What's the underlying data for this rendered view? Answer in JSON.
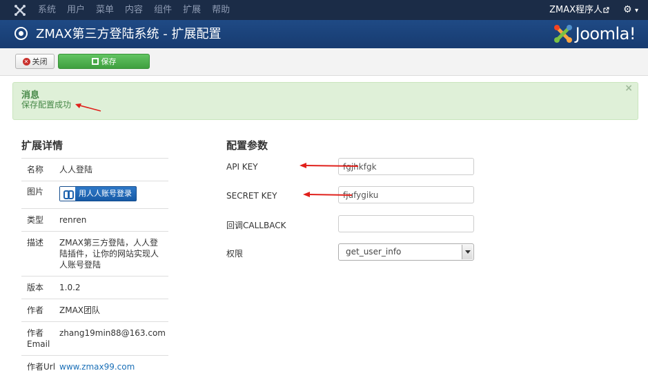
{
  "topnav": {
    "menu": [
      "系统",
      "用户",
      "菜单",
      "内容",
      "组件",
      "扩展",
      "帮助"
    ],
    "user": "ZMAX程序人",
    "gear_caret": "▾"
  },
  "header": {
    "title": "ZMAX第三方登陆系统 - 扩展配置",
    "brand": "Joomla!"
  },
  "toolbar": {
    "close_label": "关闭",
    "save_label": "保存"
  },
  "alert": {
    "heading": "消息",
    "message": "保存配置成功",
    "close": "×"
  },
  "details": {
    "title": "扩展详情",
    "rows": [
      {
        "label": "名称",
        "value": "人人登陆"
      },
      {
        "label": "图片",
        "value": "用人人账号登录"
      },
      {
        "label": "类型",
        "value": "renren"
      },
      {
        "label": "描述",
        "value": "ZMAX第三方登陆，人人登陆插件，让你的网站实现人人账号登陆"
      },
      {
        "label": "版本",
        "value": "1.0.2"
      },
      {
        "label": "作者",
        "value": "ZMAX团队"
      },
      {
        "label": "作者Email",
        "value": "zhang19min88@163.com"
      },
      {
        "label": "作者Url",
        "value": "www.zmax99.com"
      }
    ]
  },
  "config": {
    "title": "配置参数",
    "api_key_label": "API KEY",
    "api_key_value": "fgjhkfgk",
    "secret_key_label": "SECRET KEY",
    "secret_key_value": "fjufygiku",
    "callback_label": "回调CALLBACK",
    "callback_value": "",
    "scope_label": "权限",
    "scope_value": "get_user_info"
  },
  "colors": {
    "annotation_arrow": "#e0201b",
    "topnav_bg": "#1b2c47",
    "header_bg": "#1f4a85",
    "save_green": "#51b351",
    "alert_bg": "#dff0d8"
  }
}
